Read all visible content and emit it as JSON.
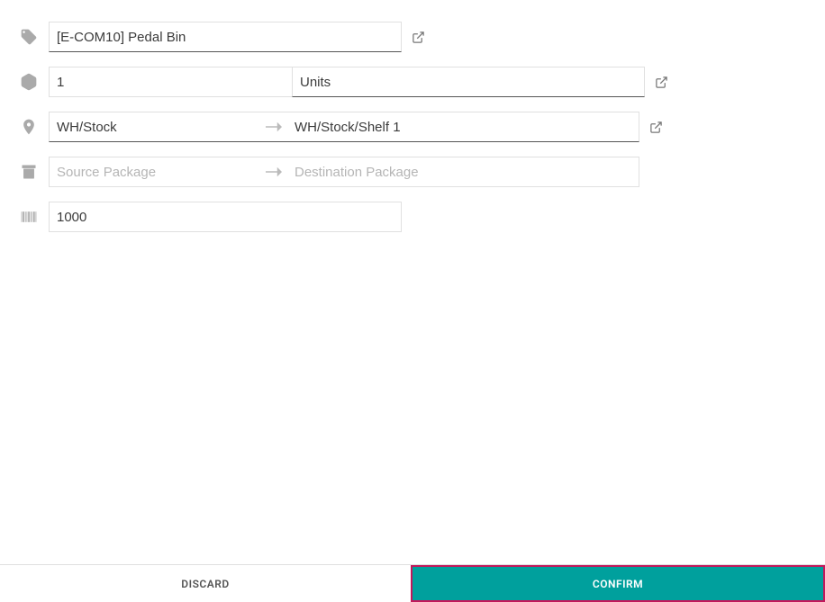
{
  "product": {
    "name": "[E-COM10] Pedal Bin"
  },
  "quantity": {
    "value": "1",
    "uom": "Units"
  },
  "location": {
    "source": "WH/Stock",
    "destination": "WH/Stock/Shelf 1"
  },
  "package": {
    "source_placeholder": "Source Package",
    "destination_placeholder": "Destination Package"
  },
  "barcode": {
    "value": "1000"
  },
  "footer": {
    "discard": "DISCARD",
    "confirm": "CONFIRM"
  }
}
